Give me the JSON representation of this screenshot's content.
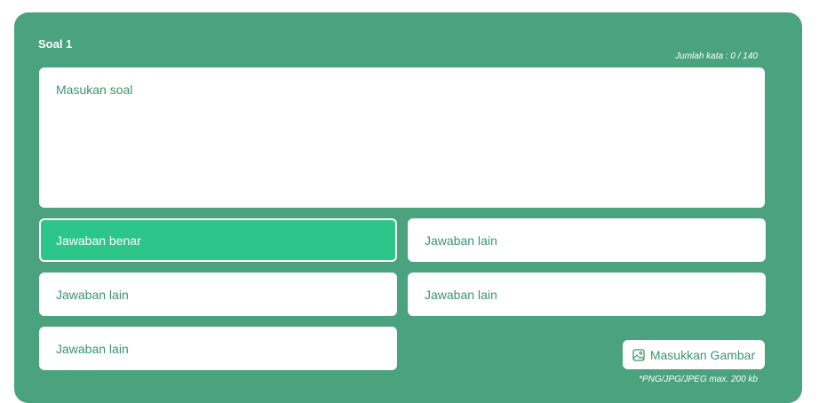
{
  "question_card": {
    "title": "Soal 1",
    "word_counter": "Jumlah kata : 0 / 140",
    "question_placeholder": "Masukan soal",
    "answers": {
      "correct": "Jawaban benar",
      "other_1": "Jawaban lain",
      "other_2": "Jawaban lain",
      "other_3": "Jawaban lain",
      "other_4": "Jawaban lain"
    },
    "image_button_label": "Masukkan Gambar",
    "image_icon": "image-icon",
    "file_note": "*PNG/JPG/JPEG max. 200 kb"
  },
  "colors": {
    "card_bg": "#4aa37e",
    "correct_answer_bg": "#2dc68a",
    "text_green": "#3c9470"
  }
}
